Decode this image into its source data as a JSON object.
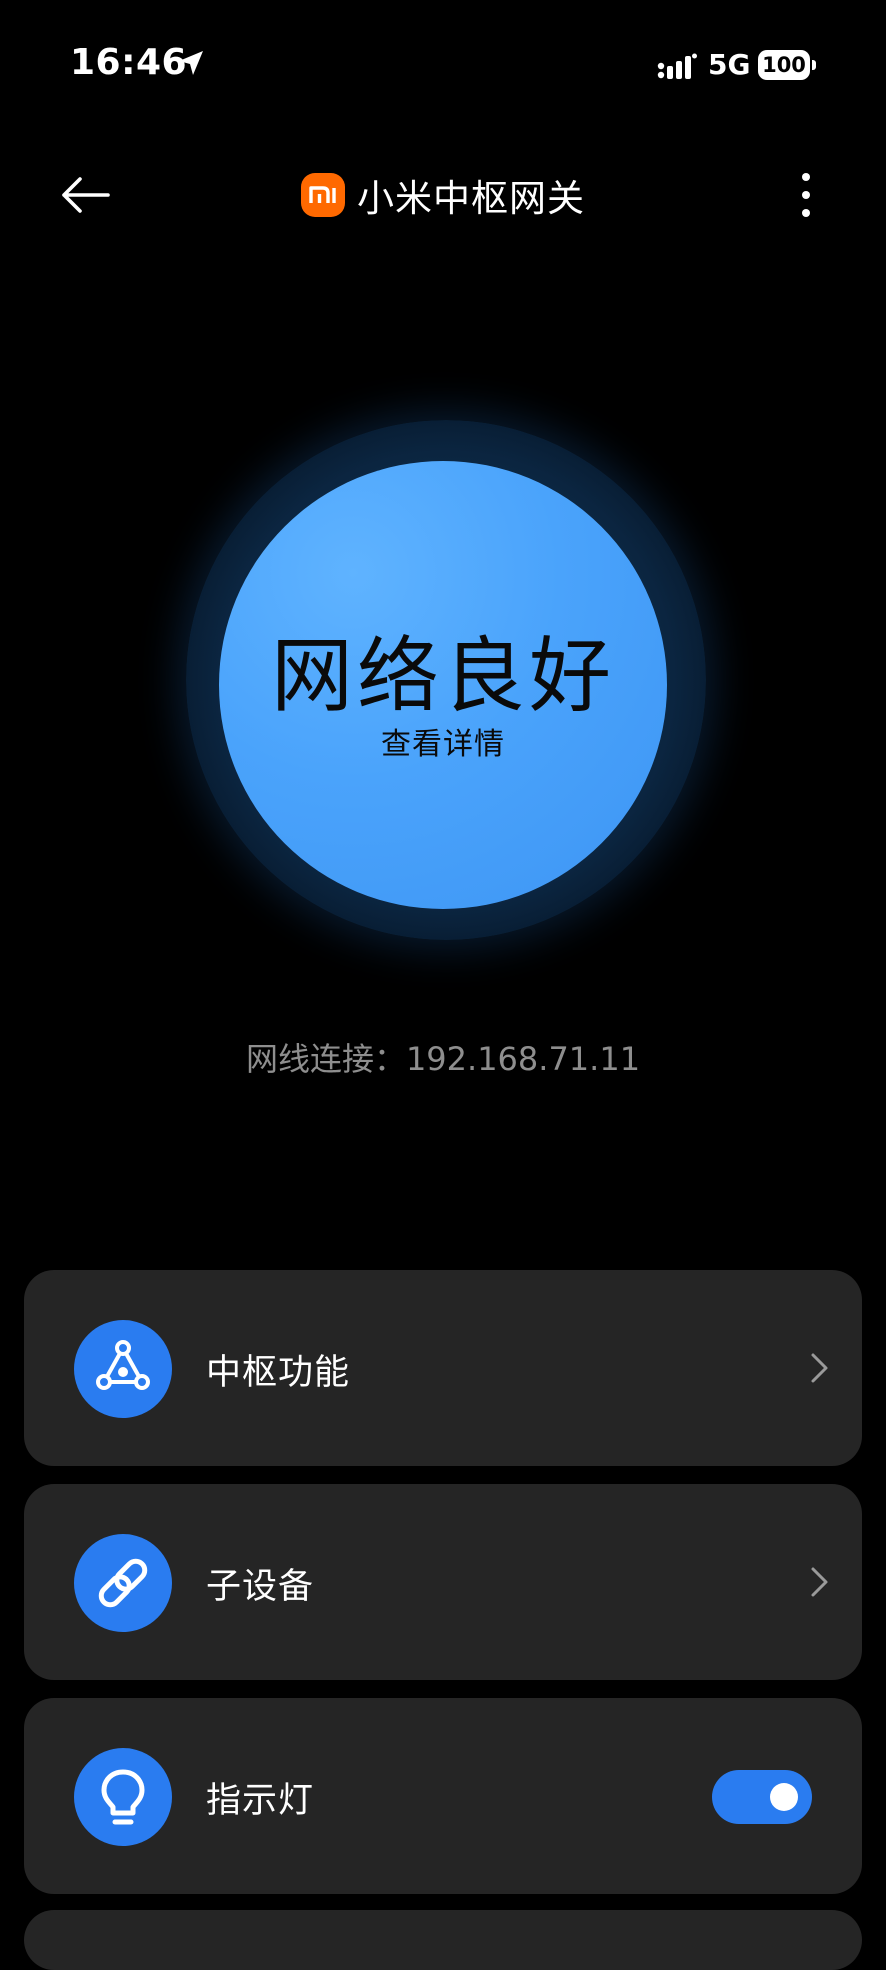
{
  "status_bar": {
    "time": "16:46",
    "network": "5G",
    "battery": "100"
  },
  "header": {
    "title": "小米中枢网关",
    "logo_text": "mi"
  },
  "status": {
    "text": "网络良好",
    "detail_link": "查看详情",
    "connection": "网线连接：192.168.71.11"
  },
  "menu": {
    "hub_functions": "中枢功能",
    "sub_devices": "子设备",
    "indicator_light": "指示灯",
    "indicator_light_on": true
  },
  "colors": {
    "accent": "#2a7cf0",
    "brand": "#ff6900",
    "card_bg": "#252525",
    "status_circle": "#4aa3fb"
  }
}
